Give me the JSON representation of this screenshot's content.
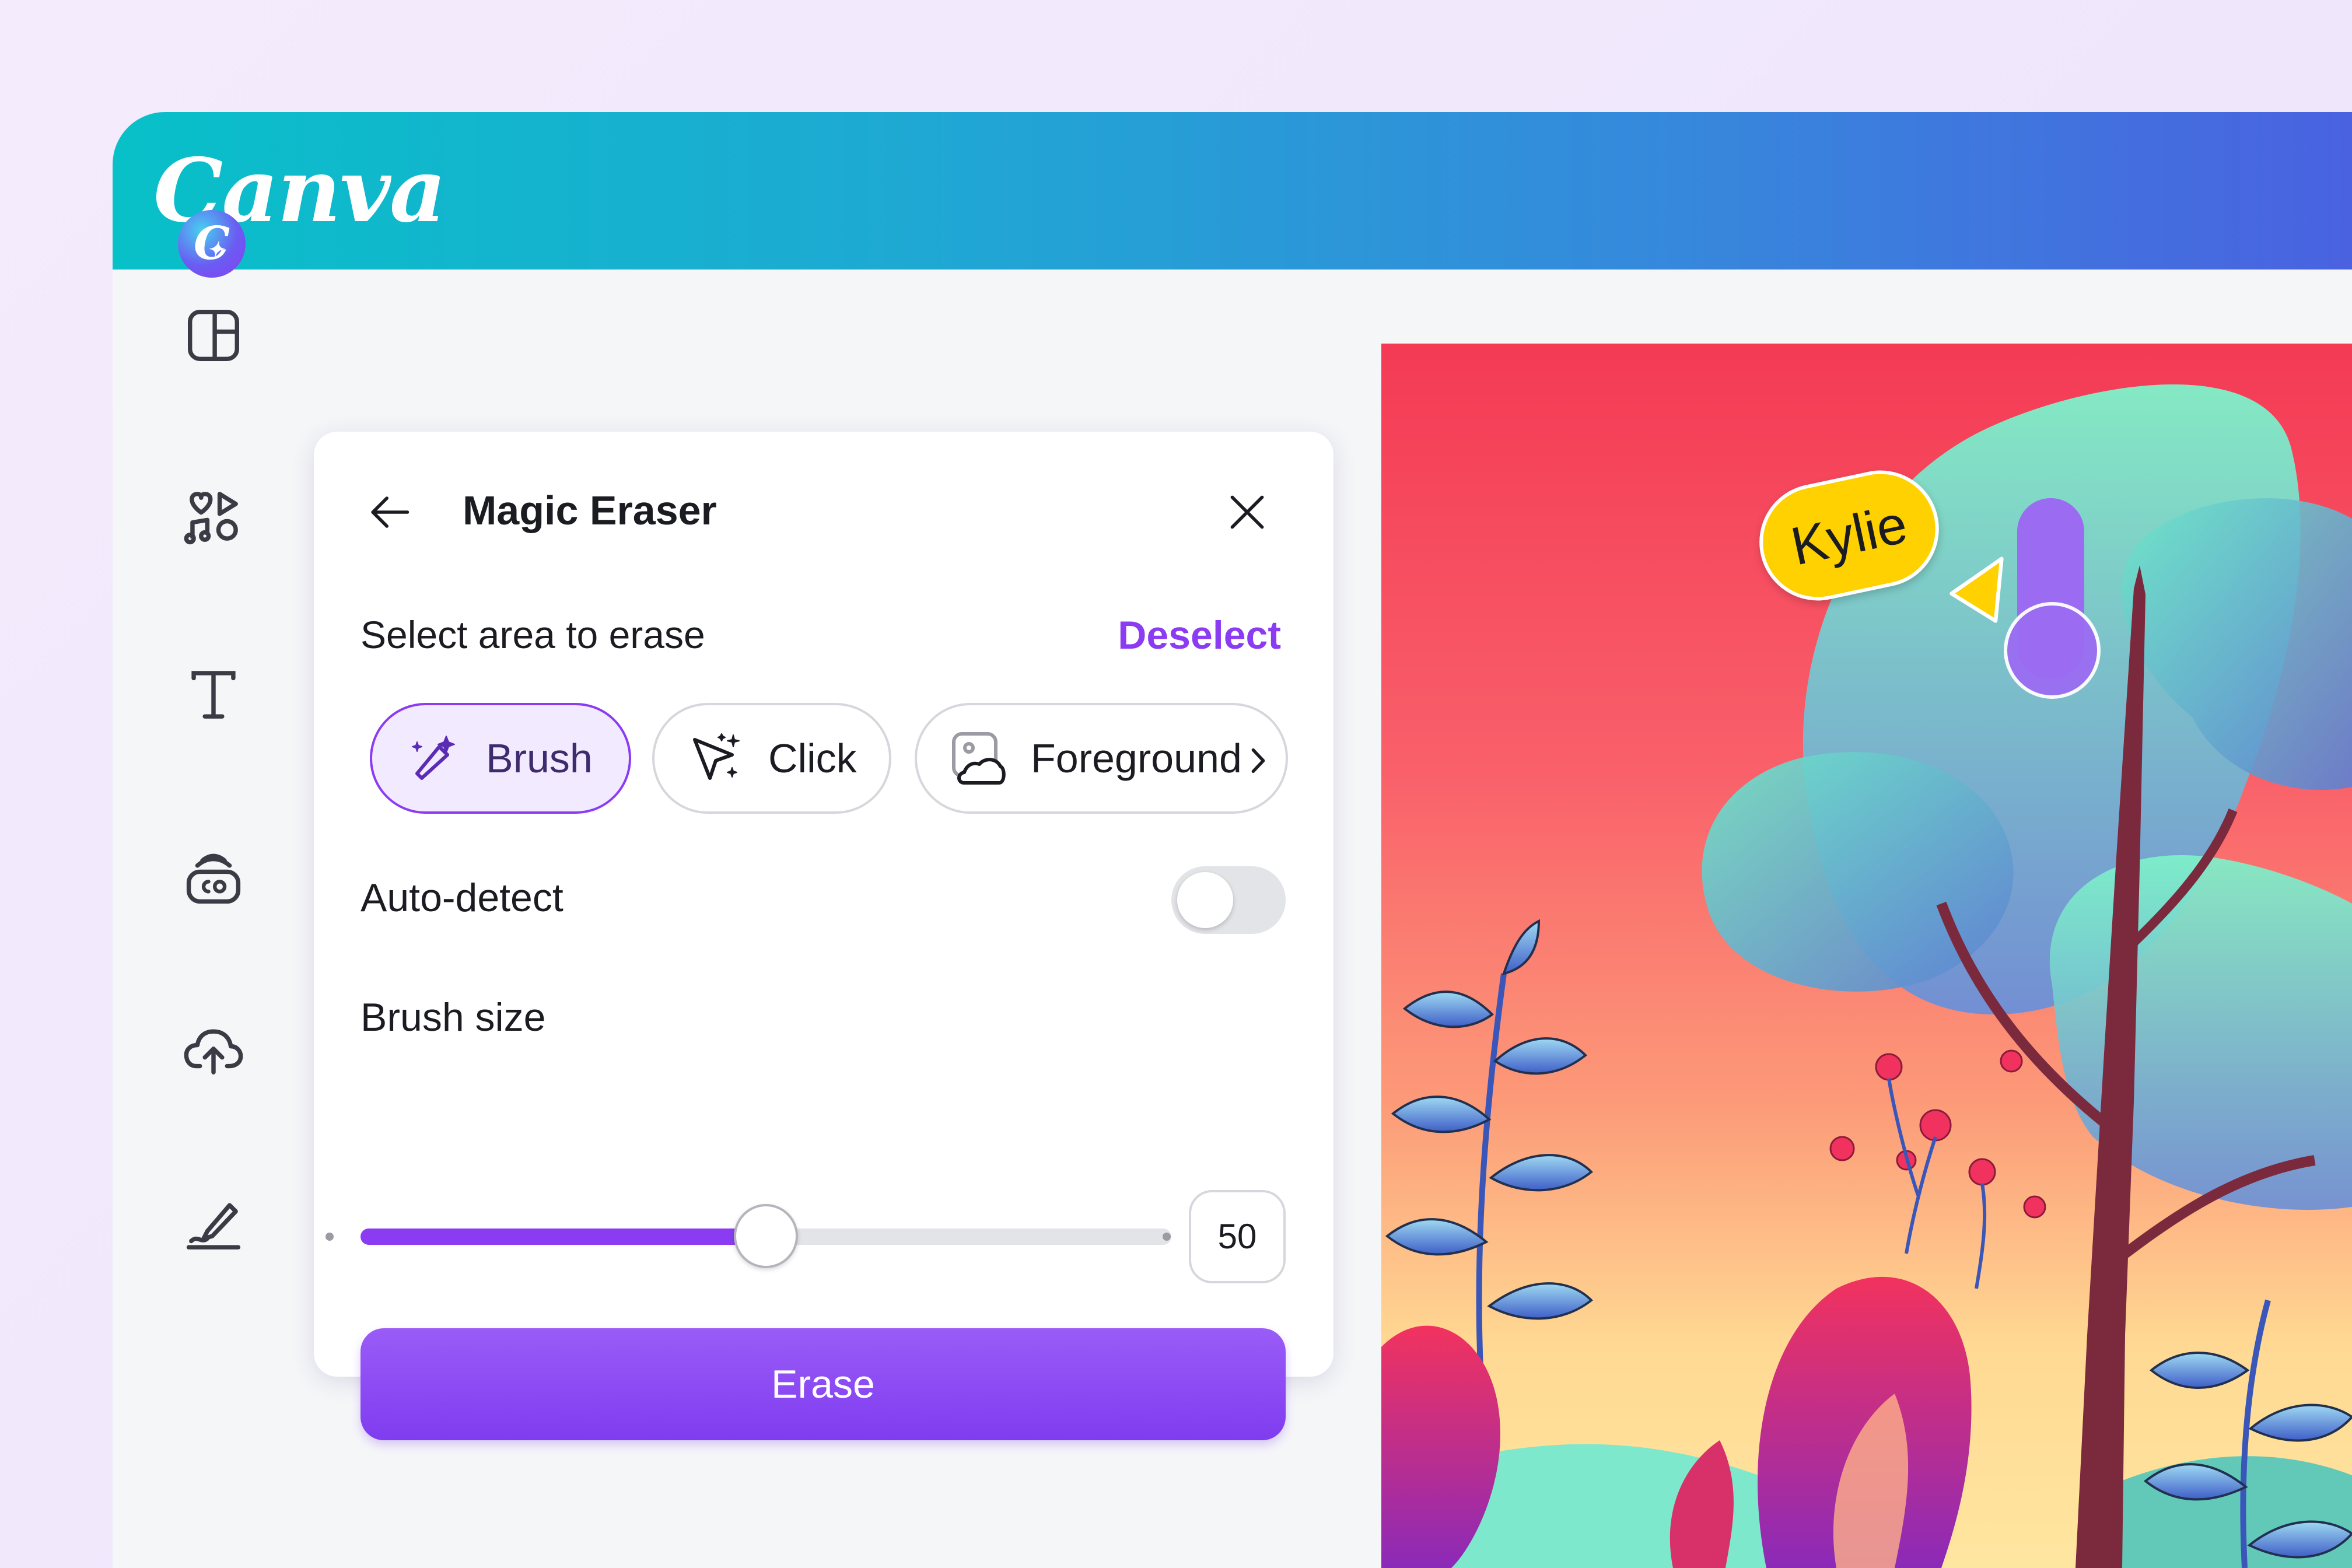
{
  "app": {
    "logo": "Canva",
    "ai_badge_letter": "C"
  },
  "sidebar": {
    "items": [
      {
        "icon": "layout-icon"
      },
      {
        "icon": "elements-icon"
      },
      {
        "icon": "text-icon"
      },
      {
        "icon": "brand-icon"
      },
      {
        "icon": "upload-icon"
      },
      {
        "icon": "draw-icon"
      }
    ]
  },
  "panel": {
    "title": "Magic Eraser",
    "section_label": "Select area to erase",
    "deselect_label": "Deselect",
    "modes": [
      {
        "label": "Brush",
        "icon": "magic-brush-icon",
        "selected": true
      },
      {
        "label": "Click",
        "icon": "sparkle-cursor-icon",
        "selected": false
      },
      {
        "label": "Foreground",
        "icon": "image-icon",
        "selected": false
      }
    ],
    "auto_detect_label": "Auto-detect",
    "auto_detect_on": false,
    "brush_size_label": "Brush size",
    "brush_size_value": "50",
    "brush_size_fraction": 0.5,
    "erase_label": "Erase"
  },
  "canvas": {
    "collaborator_name": "Kylie",
    "collaborator_color": "#ffd100",
    "brush_cursor_color": "#9b6cf2"
  },
  "colors": {
    "accent": "#8b3cf2",
    "header_start": "#08c0c8",
    "header_end": "#4a62e0"
  }
}
